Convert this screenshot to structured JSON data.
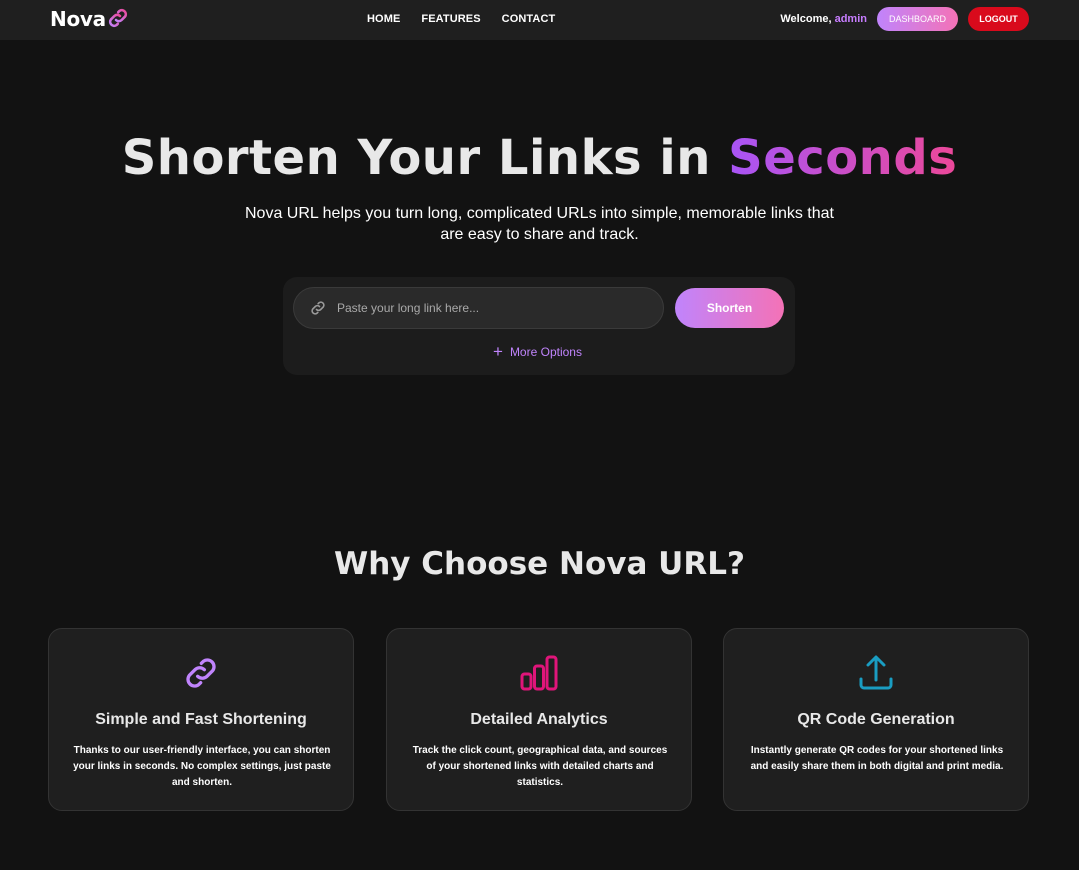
{
  "nav": {
    "logo_text": "Nova",
    "links": [
      "HOME",
      "FEATURES",
      "CONTACT"
    ],
    "welcome_prefix": "Welcome,",
    "username": "admin",
    "dashboard_label": "DASHBOARD",
    "logout_label": "LOGOUT"
  },
  "hero": {
    "title_main": "Shorten Your Links in",
    "title_highlight": "Seconds",
    "subtitle": "Nova URL helps you turn long, complicated URLs into simple, memorable links that are easy to share and track."
  },
  "shortener": {
    "input_placeholder": "Paste your long link here...",
    "input_value": "",
    "button_label": "Shorten",
    "more_options_label": "More Options"
  },
  "features": {
    "title": "Why Choose Nova URL?",
    "cards": [
      {
        "icon": "link-icon",
        "title": "Simple and Fast Shortening",
        "description": "Thanks to our user-friendly interface, you can shorten your links in seconds. No complex settings, just paste and shorten."
      },
      {
        "icon": "bar-chart-icon",
        "title": "Detailed Analytics",
        "description": "Track the click count, geographical data, and sources of your shortened links with detailed charts and statistics."
      },
      {
        "icon": "upload-icon",
        "title": "QR Code Generation",
        "description": "Instantly generate QR codes for your shortened links and easily share them in both digital and print media."
      }
    ]
  },
  "colors": {
    "background": "#121212",
    "navbar": "#1f1f1f",
    "accent_start": "#c084fc",
    "accent_end": "#f472b6",
    "logout": "#d90a1c",
    "analytics_icon": "#e0157a",
    "qr_icon": "#1a9dc2"
  }
}
